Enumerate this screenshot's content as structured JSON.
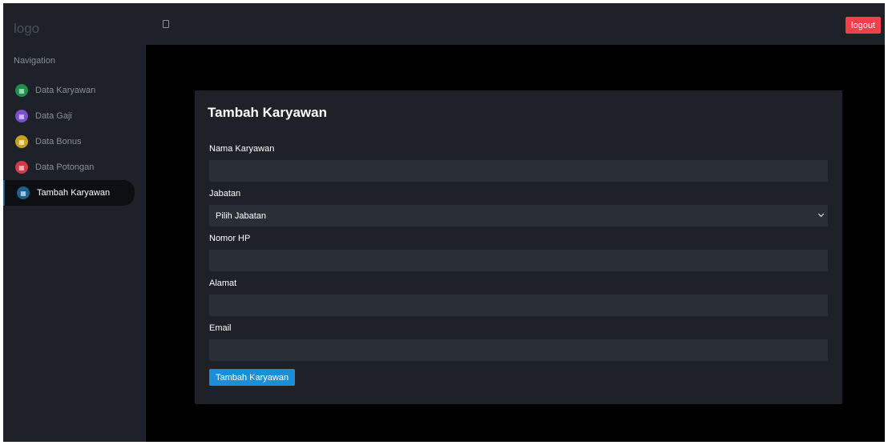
{
  "app": {
    "logo": "logo"
  },
  "sidebar": {
    "title": "Navigation",
    "items": [
      {
        "label": "Data Karyawan",
        "icon": "users-icon",
        "color": "#1e8f4c"
      },
      {
        "label": "Data Gaji",
        "icon": "money-icon",
        "color": "#7a4fd0"
      },
      {
        "label": "Data Bonus",
        "icon": "gift-icon",
        "color": "#c8a020"
      },
      {
        "label": "Data Potongan",
        "icon": "scissors-icon",
        "color": "#d03a4a"
      },
      {
        "label": "Tambah Karyawan",
        "icon": "user-plus-icon",
        "color": "#1f5f8b",
        "active": true
      }
    ]
  },
  "topbar": {
    "logout_label": "logout"
  },
  "form": {
    "title": "Tambah Karyawan",
    "fields": {
      "nama": {
        "label": "Nama Karyawan",
        "value": ""
      },
      "jabatan": {
        "label": "Jabatan",
        "selected": "Pilih Jabatan"
      },
      "hp": {
        "label": "Nomor HP",
        "value": ""
      },
      "alamat": {
        "label": "Alamat",
        "value": ""
      },
      "email": {
        "label": "Email",
        "value": ""
      }
    },
    "submit_label": "Tambah Karyawan"
  },
  "colors": {
    "sidebar_bg": "#1e2128",
    "content_bg": "#000000",
    "input_bg": "#2a2f37",
    "logout": "#f2404a",
    "primary": "#1a8fd9"
  }
}
